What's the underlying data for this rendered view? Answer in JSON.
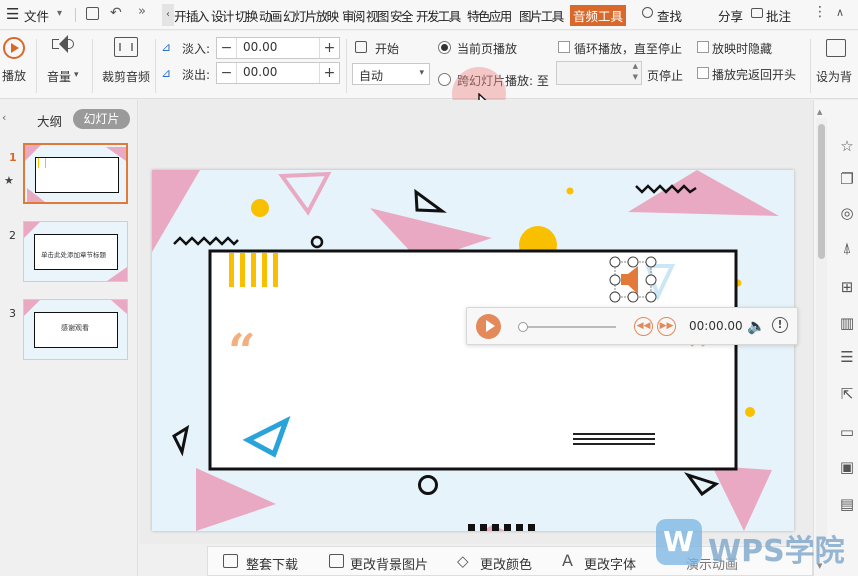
{
  "menubar": {
    "file_label": "文件",
    "tabs": [
      "开始",
      "插入",
      "设计",
      "切换",
      "动画",
      "幻灯片放映",
      "审阅",
      "视图",
      "安全",
      "开发工具",
      "特色应用",
      "图片工具"
    ],
    "active_tab": "音频工具",
    "search_label": "查找",
    "share_label": "分享",
    "comment_label": "批注"
  },
  "ribbon": {
    "play_label": "播放",
    "volume_label": "音量",
    "trim_label": "裁剪音频",
    "fade_in_label": "淡入:",
    "fade_in_value": "00.00",
    "fade_out_label": "淡出:",
    "fade_out_value": "00.00",
    "start_label": "开始",
    "start_value": "自动",
    "current_page_label": "当前页播放",
    "cross_slide_label": "跨幻灯片播放: 至",
    "page_stop_label": "页停止",
    "loop_label": "循环播放，直至停止",
    "hide_label": "放映时隐藏",
    "rewind_label": "播放完返回开头",
    "set_bg_label": "设为背"
  },
  "left_panel": {
    "tab_outline": "大纲",
    "tab_slides": "幻灯片",
    "slides": [
      {
        "number": "1",
        "title": ""
      },
      {
        "number": "2",
        "title": "单击此处添加章节标题"
      },
      {
        "number": "3",
        "title": "感谢观看"
      }
    ]
  },
  "player": {
    "time": "00:00.00",
    "progress": 0
  },
  "bottom_bar": {
    "items": [
      "整套下载",
      "更改背景图片",
      "更改颜色",
      "更改字体",
      "演示动画"
    ]
  },
  "watermark": "WPS学院",
  "colors": {
    "accent": "#d9692b",
    "pink": "#e9a9c2",
    "yellow": "#f8c000",
    "blue": "#29a3d9",
    "slide_bg": "#e6f3fa"
  }
}
